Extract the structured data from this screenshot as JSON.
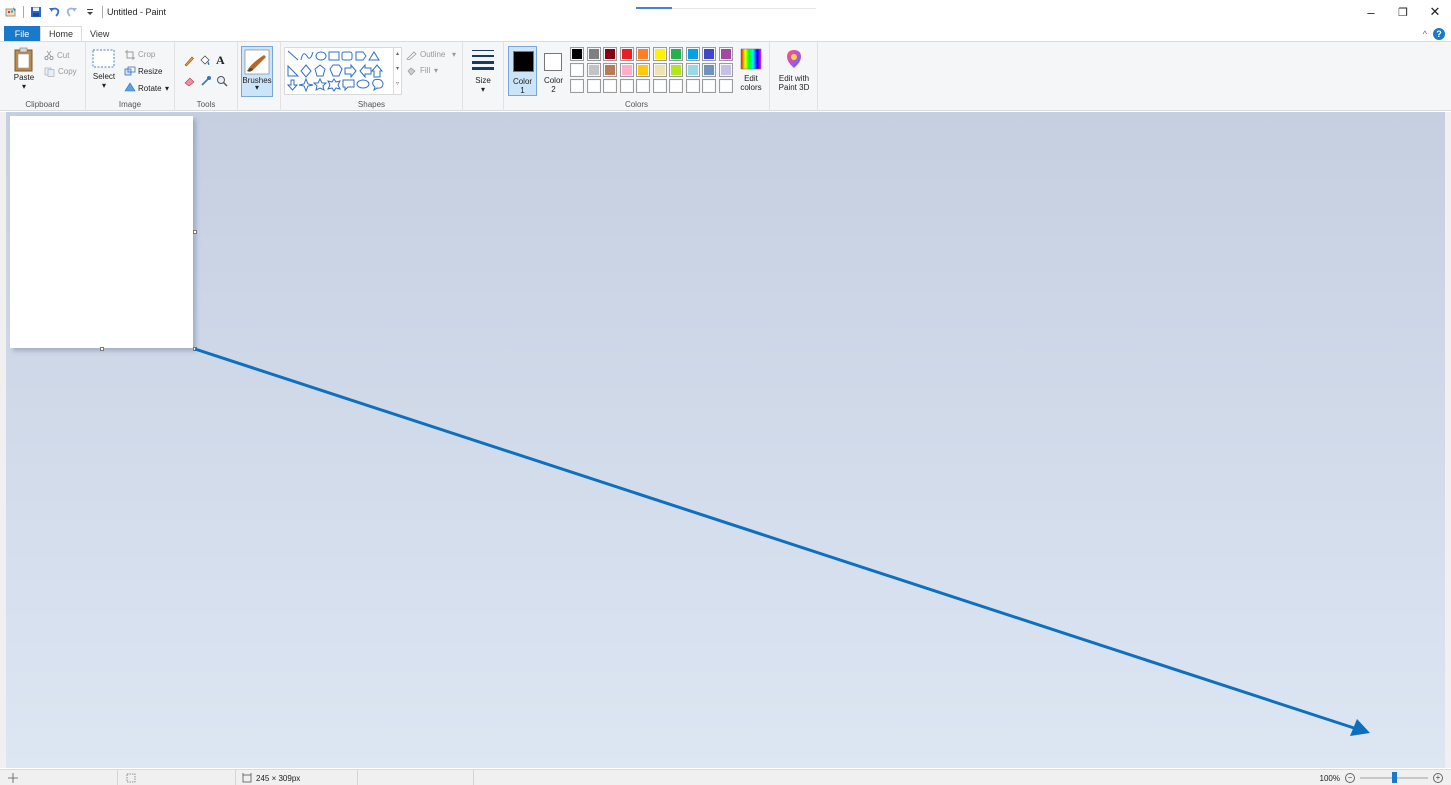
{
  "window": {
    "title": "Untitled - Paint",
    "minimize": "–",
    "maximize": "❐",
    "close": "✕"
  },
  "tabs": {
    "file": "File",
    "home": "Home",
    "view": "View"
  },
  "help": {
    "collapse": "^",
    "help": "?"
  },
  "clipboard": {
    "paste": "Paste",
    "cut": "Cut",
    "copy": "Copy",
    "group": "Clipboard"
  },
  "image": {
    "select": "Select",
    "crop": "Crop",
    "resize": "Resize",
    "rotate": "Rotate",
    "group": "Image"
  },
  "tools": {
    "group": "Tools",
    "text_tool": "A"
  },
  "brushes": {
    "label": "Brushes"
  },
  "shapes": {
    "outline": "Outline",
    "fill": "Fill",
    "group": "Shapes"
  },
  "size": {
    "label": "Size"
  },
  "colors": {
    "color1_label": "Color",
    "color1_num": "1",
    "color2_label": "Color",
    "color2_num": "2",
    "edit_colors_line1": "Edit",
    "edit_colors_line2": "colors",
    "group": "Colors",
    "color1_value": "#000000",
    "color2_value": "#ffffff",
    "palette_row1": [
      "#000000",
      "#7f7f7f",
      "#880015",
      "#ed1c24",
      "#ff7f27",
      "#fff200",
      "#22b14c",
      "#00a2e8",
      "#3f48cc",
      "#a349a4"
    ],
    "palette_row2": [
      "#ffffff",
      "#c3c3c3",
      "#b97a57",
      "#ffaec9",
      "#ffc90e",
      "#efe4b0",
      "#b5e61d",
      "#99d9ea",
      "#7092be",
      "#c8bfe7"
    ],
    "palette_row3": [
      "#ffffff",
      "#ffffff",
      "#ffffff",
      "#ffffff",
      "#ffffff",
      "#ffffff",
      "#ffffff",
      "#ffffff",
      "#ffffff",
      "#ffffff"
    ]
  },
  "paint3d": {
    "line1": "Edit with",
    "line2": "Paint 3D"
  },
  "statusbar": {
    "canvas_size": "245 × 309px",
    "zoom": "100%",
    "zoom_minus": "−",
    "zoom_plus": "+",
    "zoom_fraction": 0.5
  },
  "accent": "#1979ca",
  "arrow_color": "#0e6fbf"
}
